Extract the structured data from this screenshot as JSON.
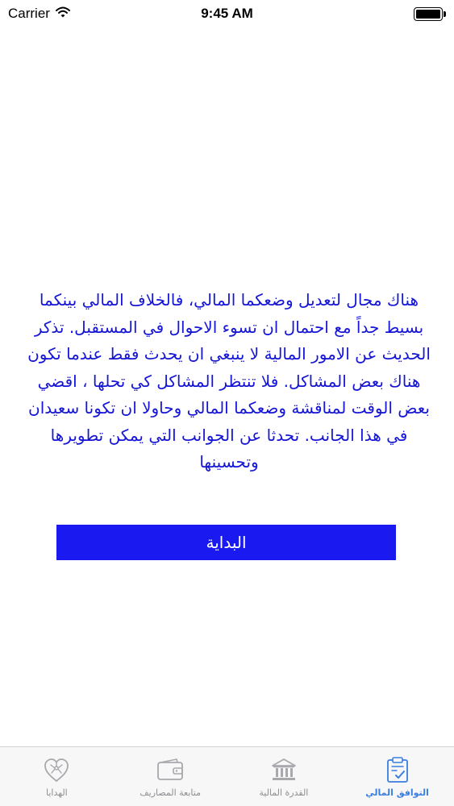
{
  "status_bar": {
    "carrier": "Carrier",
    "time": "9:45 AM",
    "icons": {
      "wifi": "wifi-icon",
      "battery": "battery-icon"
    }
  },
  "content": {
    "message": "هناك مجال لتعديل وضعكما المالي، فالخلاف المالي بينكما بسيط جداً مع احتمال ان تسوء الاحوال في المستقبل. تذكر الحديث عن الامور المالية لا ينبغي ان يحدث فقط عندما تكون هناك بعض المشاكل. فلا تنتظر المشاكل كي تحلها ، اقضي بعض الوقت لمناقشة وضعكما المالي وحاولا ان تكونا سعيدان في هذا الجانب. تحدثا عن الجوانب التي يمكن تطويرها وتحسينها",
    "start_button_label": "البداية"
  },
  "tab_bar": {
    "tabs": [
      {
        "label": "الهدايا",
        "icon": "gift-heart-icon"
      },
      {
        "label": "متابعة المصاريف",
        "icon": "wallet-icon"
      },
      {
        "label": "القدرة المالية",
        "icon": "bank-icon"
      },
      {
        "label": "التوافق المالي",
        "icon": "clipboard-check-icon",
        "active": true
      }
    ]
  },
  "colors": {
    "text_blue": "#1515d6",
    "button_blue": "#1a1af0",
    "tab_active": "#3a7ee0",
    "tab_inactive": "#8e8e93"
  }
}
